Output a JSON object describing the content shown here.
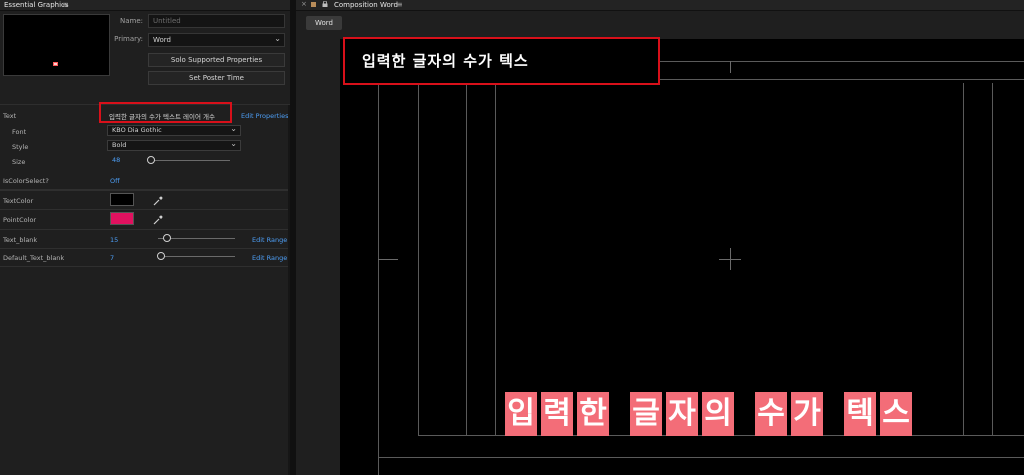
{
  "essential_graphics": {
    "panel_title": "Essential Graphics",
    "menu_icon": "hamburger-menu-icon",
    "name_label": "Name:",
    "name_placeholder": "Untitled",
    "primary_label": "Primary:",
    "primary_value": "Word",
    "solo_button": "Solo Supported Properties",
    "poster_button": "Set Poster Time",
    "properties": {
      "text": {
        "label": "Text",
        "value": "입력한 글자의 수가 텍스트 레이어 개수",
        "edit_link": "Edit Properties",
        "font_label": "Font",
        "font_value": "KBO Dia Gothic",
        "style_label": "Style",
        "style_value": "Bold",
        "size_label": "Size",
        "size_value": "48"
      },
      "is_color_select": {
        "label": "IsColorSelect?",
        "value": "Off"
      },
      "text_color": {
        "label": "TextColor",
        "color": "#000000"
      },
      "point_color": {
        "label": "PointColor",
        "color": "#e0115f"
      },
      "text_blank": {
        "label": "Text_blank",
        "value": "15",
        "edit_link": "Edit Range"
      },
      "default_text_blank": {
        "label": "Default_Text_blank",
        "value": "7",
        "edit_link": "Edit Range"
      }
    }
  },
  "composition": {
    "tab_label": "Composition Word",
    "active_tab": "Word",
    "preview_text_top": "입력한 글자의 수가 텍스",
    "preview_glyphs": [
      "입",
      "력",
      "한",
      " ",
      "글",
      "자",
      "의",
      " ",
      "수",
      "가",
      " ",
      "텍",
      "스"
    ],
    "glyph_color": "#f36d78",
    "highlight_color": "#d8101a"
  }
}
